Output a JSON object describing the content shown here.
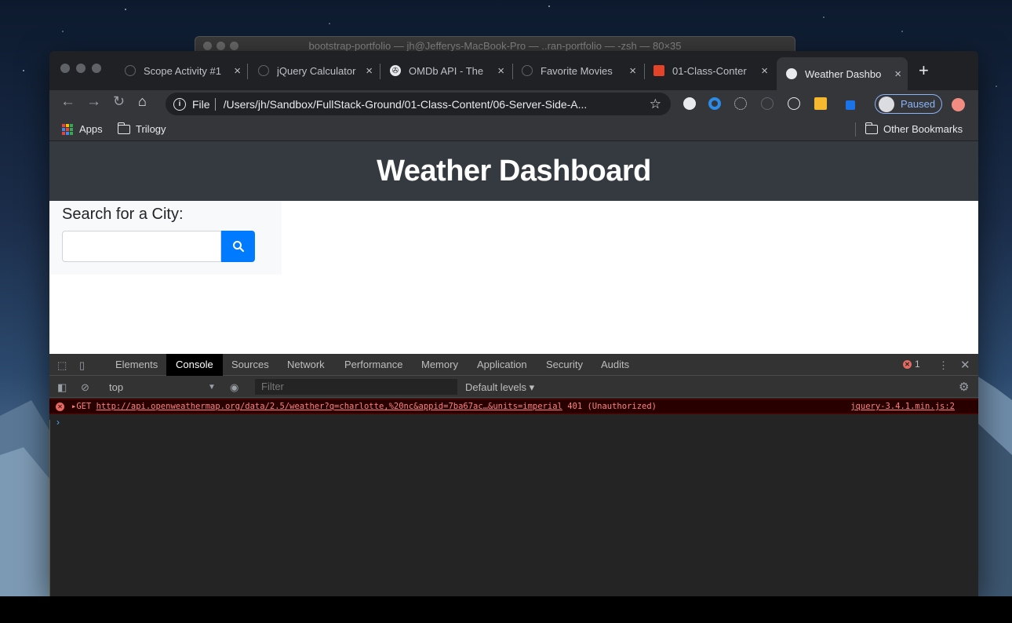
{
  "terminal": {
    "title": "bootstrap-portfolio — jh@Jefferys-MacBook-Pro — ..ran-portfolio — -zsh — 80×35"
  },
  "tabs": [
    {
      "label": "Scope Activity #1"
    },
    {
      "label": "jQuery Calculator"
    },
    {
      "label": "OMDb API - The"
    },
    {
      "label": "Favorite Movies"
    },
    {
      "label": "01-Class-Conter"
    },
    {
      "label": "Weather Dashbo"
    }
  ],
  "toolbar": {
    "file_label": "File",
    "url": "/Users/jh/Sandbox/FullStack-Ground/01-Class-Content/06-Server-Side-A...",
    "paused_label": "Paused"
  },
  "bookmarks": {
    "apps": "Apps",
    "trilogy": "Trilogy",
    "other": "Other Bookmarks"
  },
  "page": {
    "title": "Weather Dashboard",
    "search_heading": "Search for a City:",
    "city_value": ""
  },
  "devtools": {
    "tabs": [
      "Elements",
      "Console",
      "Sources",
      "Network",
      "Performance",
      "Memory",
      "Application",
      "Security",
      "Audits"
    ],
    "active_tab": "Console",
    "error_count": "1",
    "context": "top",
    "filter_placeholder": "Filter",
    "levels": "Default levels ▾",
    "error": {
      "method": "▸GET",
      "url": "http://api.openweathermap.org/data/2.5/weather?q=charlotte,%20nc&appid=7ba67ac…&units=imperial",
      "status": "401 (Unauthorized)",
      "source": "jquery-3.4.1.min.js:2"
    },
    "prompt": "›"
  },
  "colors": {
    "jumbotron": "#343a40",
    "search_button": "#007bff",
    "error_bg": "#290000"
  }
}
